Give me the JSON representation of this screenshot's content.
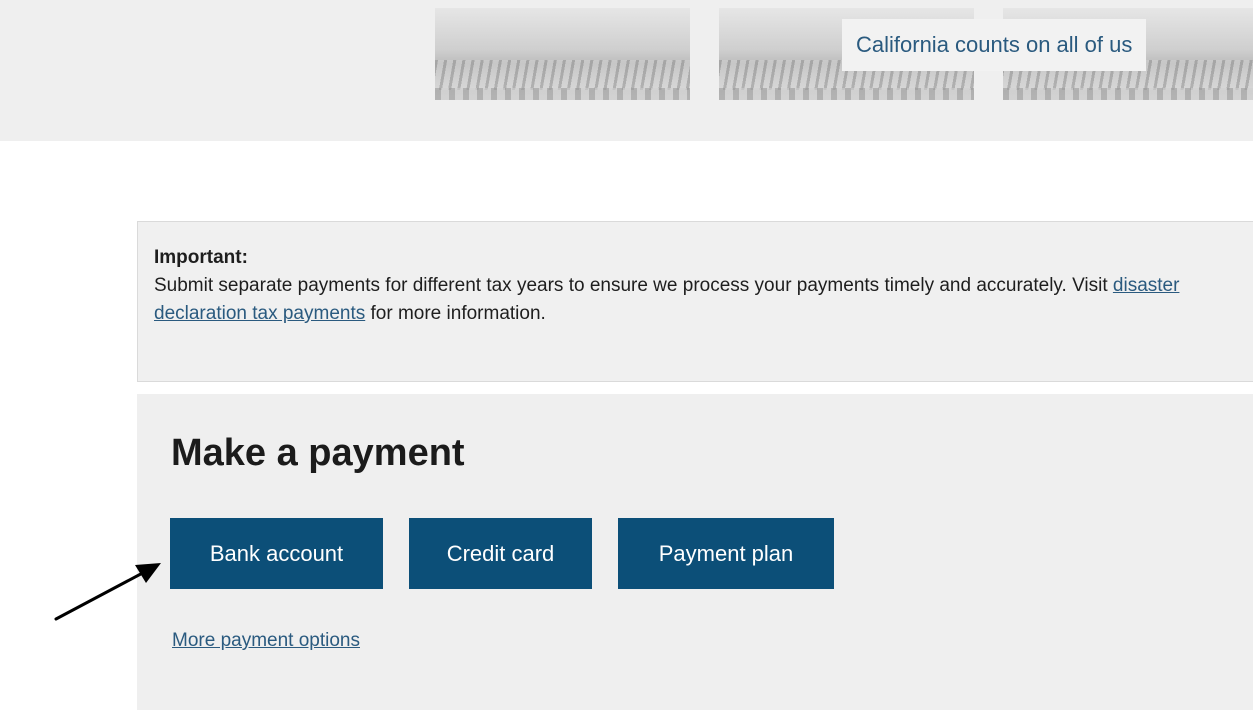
{
  "banner": {
    "tagline": "California counts on all of us"
  },
  "notice": {
    "title": "Important:",
    "body_before_link": "Submit separate payments for different tax years to ensure we process your payments timely and accurately. Visit ",
    "link_text": "disaster declaration tax payments",
    "body_after_link": " for more information."
  },
  "payment": {
    "heading": "Make a payment",
    "buttons": {
      "bank": "Bank account",
      "credit": "Credit card",
      "plan": "Payment plan"
    },
    "more_link": "More payment options"
  },
  "colors": {
    "primary_button": "#0c4f78",
    "link": "#2a5a7f",
    "panel_background": "#efefef"
  },
  "annotation": {
    "arrow_icon": "arrow-pointer-icon",
    "points_to": "Bank account"
  }
}
